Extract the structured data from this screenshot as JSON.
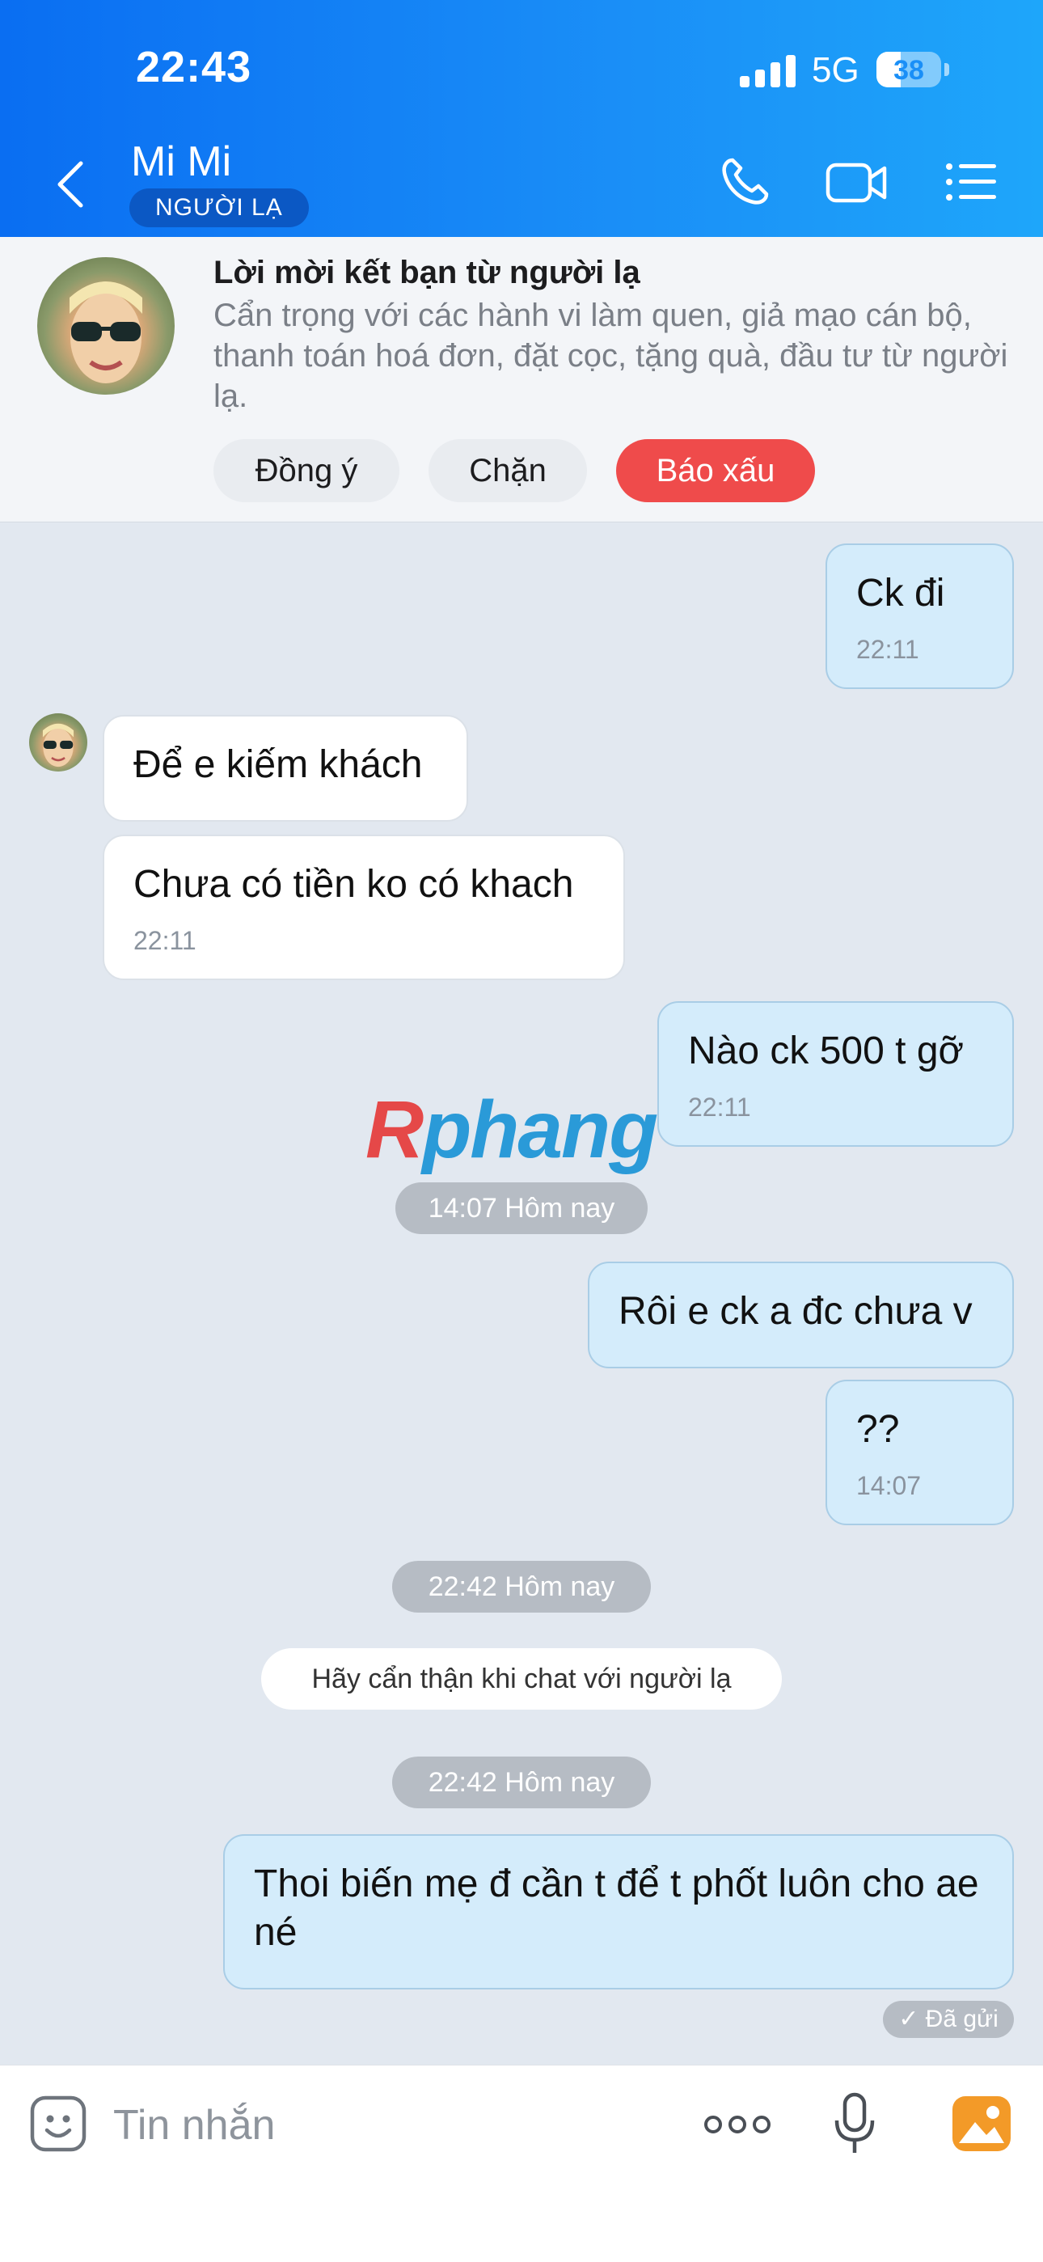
{
  "status_bar": {
    "time": "22:43",
    "network": "5G",
    "battery": "38",
    "battery_level": 0.38
  },
  "header": {
    "name": "Mi Mi",
    "badge": "NGƯỜI LẠ"
  },
  "friend_request": {
    "title": "Lời mời kết bạn từ người lạ",
    "description": "Cẩn trọng với các hành vi làm quen, giả mạo cán bộ, thanh toán hoá đơn, đặt cọc, tặng quà, đầu tư từ người lạ.",
    "accept_label": "Đồng ý",
    "block_label": "Chặn",
    "report_label": "Báo xấu",
    "report_color": "#ef4b4b"
  },
  "messages": [
    {
      "text": "Ck đi",
      "time": "22:11",
      "direction": "out"
    },
    {
      "text": "Để e kiếm khách",
      "time": "",
      "direction": "in"
    },
    {
      "text": "Chưa có tiền ko có khach",
      "time": "22:11",
      "direction": "in"
    },
    {
      "text": "Nào ck 500 t gỡ",
      "time": "22:11",
      "direction": "out"
    },
    {
      "text": "Rôi e ck a đc chưa v",
      "time": "",
      "direction": "out"
    },
    {
      "text": "??",
      "time": "14:07",
      "direction": "out"
    },
    {
      "text": "Thoi biến mẹ đ cần t để t phốt luôn cho ae né",
      "time": "",
      "direction": "out"
    }
  ],
  "dividers": [
    "14:07 Hôm nay",
    "22:42 Hôm nay",
    "22:42 Hôm nay"
  ],
  "notice": "Hãy cẩn thận khi chat với người lạ",
  "sent_status": "Đã gửi",
  "watermark": {
    "part1": "R",
    "part2": "phang"
  },
  "composer": {
    "placeholder": "Tin nhắn"
  },
  "colors": {
    "header_start": "#0a6ef2",
    "header_end": "#1ea6fa",
    "outgoing_bubble": "#d4ecfb",
    "chat_bg": "#e2e8f0"
  }
}
